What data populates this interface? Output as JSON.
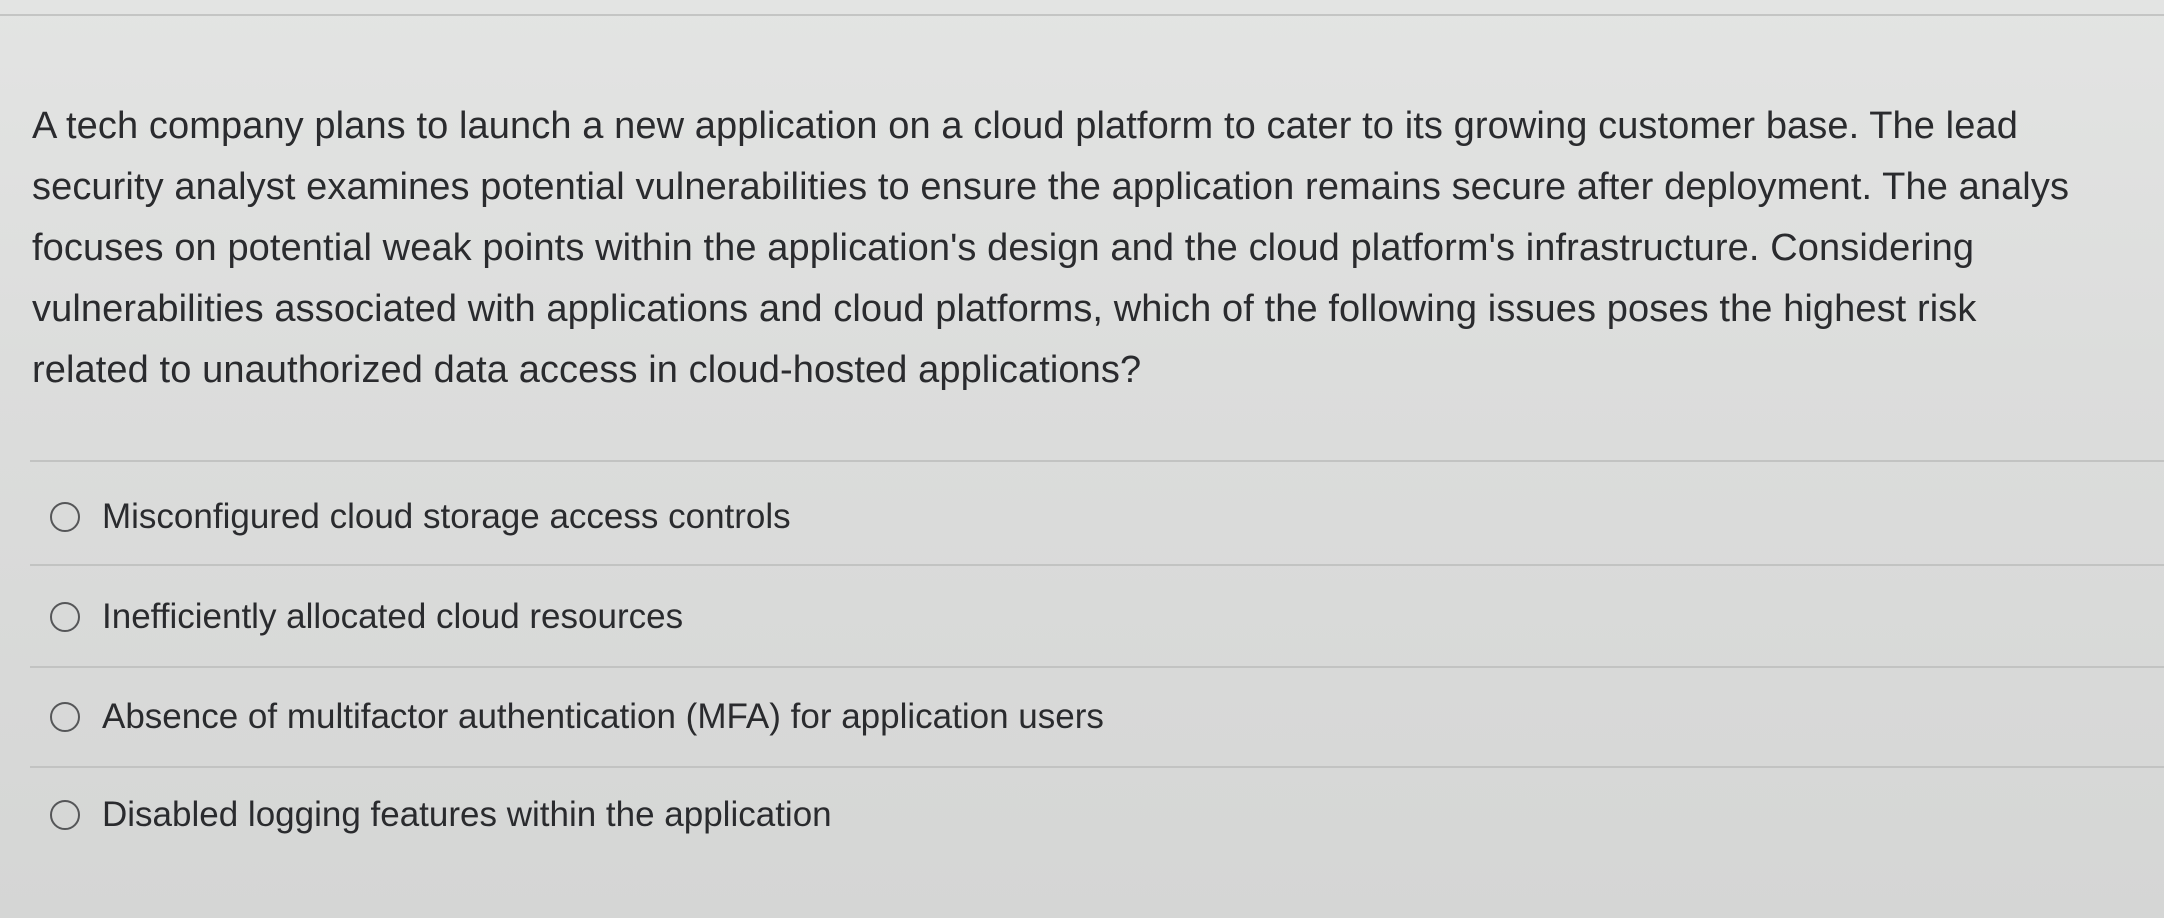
{
  "question": {
    "lines": [
      "A tech company plans to launch a new application on a cloud platform to cater to its growing customer base. The lead",
      "security analyst examines potential vulnerabilities to ensure the application remains secure after deployment. The analys",
      "focuses on potential weak points within the application's design and the cloud platform's infrastructure. Considering",
      "vulnerabilities associated with applications and cloud platforms, which of the following issues poses the highest risk",
      "related to unauthorized data access in cloud-hosted applications?"
    ]
  },
  "options": [
    {
      "label": "Misconfigured cloud storage access controls",
      "selected": false
    },
    {
      "label": "Inefficiently allocated cloud resources",
      "selected": false
    },
    {
      "label": "Absence of multifactor authentication (MFA) for application users",
      "selected": false
    },
    {
      "label": "Disabled logging features within the application",
      "selected": false
    }
  ]
}
